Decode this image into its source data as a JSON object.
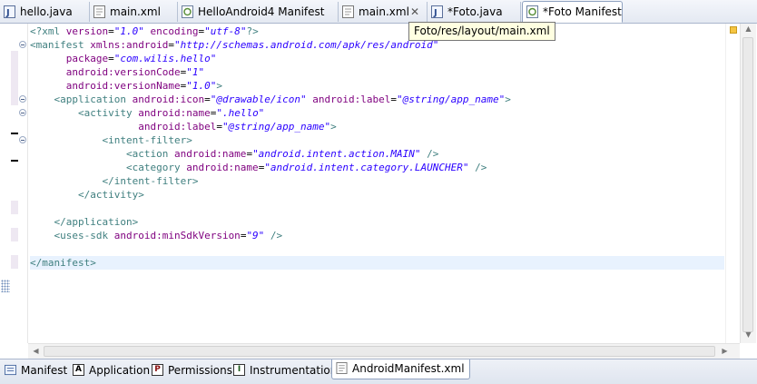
{
  "editor_tabs": [
    {
      "label": "hello.java",
      "icon": "java-file-icon"
    },
    {
      "label": "main.xml",
      "icon": "xml-file-icon"
    },
    {
      "label": "HelloAndroid4 Manifest",
      "icon": "android-manifest-icon"
    },
    {
      "label": "main.xml",
      "icon": "xml-file-icon"
    },
    {
      "label": "*Foto.java",
      "icon": "java-file-icon"
    },
    {
      "label": "*Foto Manifest",
      "icon": "android-manifest-icon"
    }
  ],
  "tooltip": "Foto/res/layout/main.xml",
  "code": {
    "l1_open": "<?xml ",
    "l1_attr1": "version",
    "l1_eq1": "=",
    "l1_val1": "\"1.0\"",
    "l1_attr2": "encoding",
    "l1_eq2": "=",
    "l1_val2": "\"utf-8\"",
    "l1_close": "?>",
    "l2_open": "<manifest ",
    "l2_attr": "xmlns:android",
    "l2_eq": "=",
    "l2_val": "\"http://schemas.android.com/apk/res/android\"",
    "l3_attr": "package",
    "l3_eq": "=",
    "l3_val": "\"com.wilis.hello\"",
    "l4_attr": "android:versionCode",
    "l4_eq": "=",
    "l4_val": "\"1\"",
    "l5_attr": "android:versionName",
    "l5_eq": "=",
    "l5_val": "\"1.0\"",
    "l5_close": ">",
    "l6_open": "<application ",
    "l6_attr1": "android:icon",
    "l6_eq1": "=",
    "l6_val1": "\"@drawable/icon\"",
    "l6_attr2": "android:label",
    "l6_eq2": "=",
    "l6_val2": "\"@string/app_name\"",
    "l6_close": ">",
    "l7_open": "<activity ",
    "l7_attr": "android:name",
    "l7_eq": "=",
    "l7_val": "\".hello\"",
    "l8_attr": "android:label",
    "l8_eq": "=",
    "l8_val": "\"@string/app_name\"",
    "l8_close": ">",
    "l9_tag": "<intent-filter>",
    "l10_open": "<action ",
    "l10_attr": "android:name",
    "l10_eq": "=",
    "l10_val": "\"android.intent.action.MAIN\"",
    "l10_close": " />",
    "l11_open": "<category ",
    "l11_attr": "android:name",
    "l11_eq": "=",
    "l11_val": "\"android.intent.category.LAUNCHER\"",
    "l11_close": " />",
    "l12_tag": "</intent-filter>",
    "l13_tag": "</activity>",
    "l15_tag": "</application>",
    "l16_open": "<uses-sdk ",
    "l16_attr": "android:minSdkVersion",
    "l16_eq": "=",
    "l16_val": "\"9\"",
    "l16_close": " />",
    "l18_tag": "</manifest>"
  },
  "bottom_tabs": [
    {
      "label": "Manifest",
      "icon_letter": ""
    },
    {
      "label": "Application",
      "icon_letter": "A"
    },
    {
      "label": "Permissions",
      "icon_letter": "P"
    },
    {
      "label": "Instrumentation",
      "icon_letter": "I"
    },
    {
      "label": "AndroidManifest.xml",
      "icon_letter": ""
    }
  ],
  "colors": {
    "tag": "#3f7f7f",
    "attribute": "#7f007f",
    "value": "#2a00ff",
    "current_line": "#e8f2fe",
    "tooltip_bg": "#ffffe1"
  }
}
